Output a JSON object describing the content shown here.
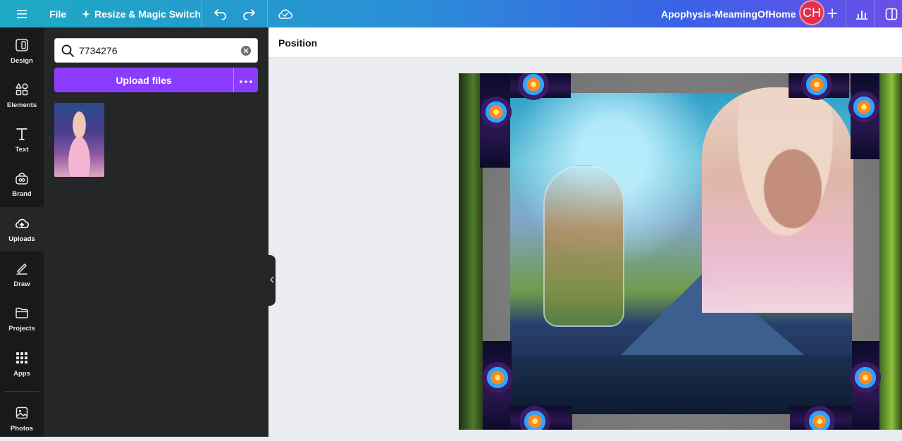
{
  "topbar": {
    "menu_icon": "hamburger-icon",
    "file_label": "File",
    "resize_label": "Resize & Magic Switch",
    "resize_icon": "sparkle-icon",
    "undo_icon": "undo-icon",
    "redo_icon": "redo-icon",
    "save_status_icon": "cloud-check-icon",
    "document_title": "Apophysis-MeamingOfHome",
    "avatar_initials": "CH",
    "share_plus_icon": "plus-icon",
    "insights_icon": "bar-chart-icon",
    "present_icon": "present-icon",
    "gradient_colors": [
      "#1eaac3",
      "#3a62e6",
      "#6a4fe8"
    ]
  },
  "rail": {
    "items": [
      {
        "label": "Design",
        "icon": "design-icon"
      },
      {
        "label": "Elements",
        "icon": "elements-icon"
      },
      {
        "label": "Text",
        "icon": "text-icon"
      },
      {
        "label": "Brand",
        "icon": "brand-icon"
      },
      {
        "label": "Uploads",
        "icon": "upload-cloud-icon",
        "active": true
      },
      {
        "label": "Draw",
        "icon": "draw-icon"
      },
      {
        "label": "Projects",
        "icon": "folder-icon"
      },
      {
        "label": "Apps",
        "icon": "apps-grid-icon"
      },
      {
        "label": "Photos",
        "icon": "photo-icon"
      }
    ]
  },
  "panel": {
    "search_value": "7734276",
    "upload_label": "Upload files",
    "more_icon": "more-dots-icon",
    "accent_color": "#8b3dff"
  },
  "context_toolbar": {
    "position_label": "Position"
  }
}
